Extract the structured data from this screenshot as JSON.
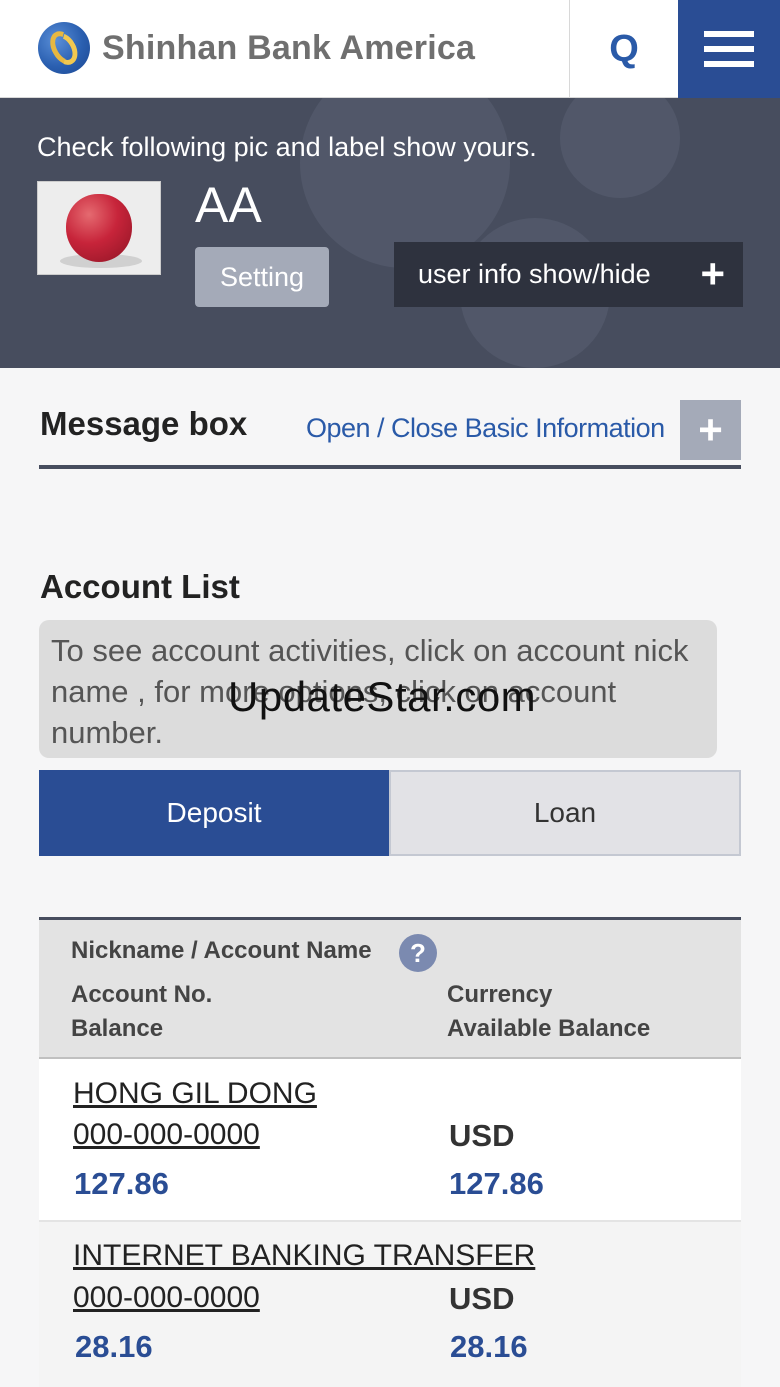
{
  "header": {
    "brand": "Shinhan Bank America",
    "search_label": "Q"
  },
  "user_panel": {
    "check_text": "Check following pic and label show yours.",
    "username": "AA",
    "setting_label": "Setting",
    "user_info_toggle_label": "user info show/hide",
    "user_info_toggle_icon": "+"
  },
  "message_box": {
    "title": "Message box",
    "toggle_link": "Open / Close Basic Information",
    "toggle_icon": "+"
  },
  "account_list": {
    "title": "Account List",
    "info_text": "To see account activities, click on account nick name , for more options, click on account number.",
    "watermark": "UpdateStar.com",
    "tabs": [
      {
        "label": "Deposit",
        "active": true
      },
      {
        "label": "Loan",
        "active": false
      }
    ],
    "table_header": {
      "nickname": "Nickname / Account Name",
      "help_icon": "?",
      "account_no": "Account No.",
      "balance": "Balance",
      "currency": "Currency",
      "available_balance": "Available Balance"
    },
    "rows": [
      {
        "nickname": "HONG GIL DONG",
        "account_no": "000-000-0000",
        "balance": "127.86",
        "currency": "USD",
        "available_balance": "127.86"
      },
      {
        "nickname": "INTERNET BANKING TRANSFER",
        "account_no": "000-000-0000",
        "balance": "28.16",
        "currency": "USD",
        "available_balance": "28.16"
      }
    ]
  },
  "colors": {
    "brand_navy": "#2a4d94",
    "panel_dark": "#474d5e",
    "link_blue": "#2a5aa8",
    "balance_blue": "#2a4d94"
  }
}
